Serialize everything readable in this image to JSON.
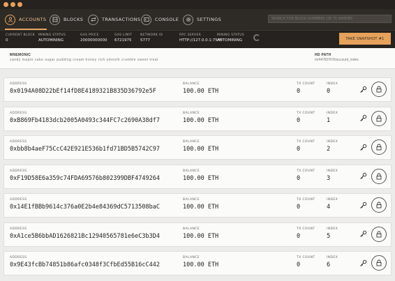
{
  "nav": {
    "items": [
      {
        "label": "ACCOUNTS",
        "icon": "accounts-icon",
        "active": true
      },
      {
        "label": "BLOCKS",
        "icon": "blocks-icon",
        "active": false
      },
      {
        "label": "TRANSACTIONS",
        "icon": "transactions-icon",
        "active": false
      },
      {
        "label": "CONSOLE",
        "icon": "console-icon",
        "active": false
      },
      {
        "label": "SETTINGS",
        "icon": "settings-icon",
        "active": false
      }
    ],
    "search_placeholder": "SEARCH FOR BLOCK NUMBERS OR TX HASHES"
  },
  "status": {
    "current_block": {
      "label": "CURRENT BLOCK",
      "value": "0"
    },
    "gas_price": {
      "label": "GAS PRICE",
      "value": "20000000000"
    },
    "gas_limit": {
      "label": "GAS LIMIT",
      "value": "6721975"
    },
    "network_id": {
      "label": "NETWORK ID",
      "value": "5777"
    },
    "rpc_server": {
      "label": "RPC SERVER",
      "value": "HTTP://127.0.0.1:7545"
    },
    "mining_status": {
      "label": "MINING STATUS",
      "value": "AUTOMINING"
    },
    "snapshot_button": "TAKE SNAPSHOT #1"
  },
  "mnemonic": {
    "label": "MNEMONIC",
    "value": "candy maple cake sugar pudding cream honey rich smooth crumble sweet treat",
    "hd_path_label": "HD PATH",
    "hd_path_value": "m/44'/60'/0'/0/account_index"
  },
  "labels": {
    "address": "ADDRESS",
    "balance": "BALANCE",
    "tx_count": "TX COUNT",
    "index": "INDEX"
  },
  "accounts": [
    {
      "address": "0x0194A08D22bEf14fD8E4189321B835D36792e5F",
      "balance": "100.00 ETH",
      "tx_count": "0",
      "index": "0"
    },
    {
      "address": "0xB869Fb4183dcb2005A0493c344FC7c2690A38df7",
      "balance": "100.00 ETH",
      "tx_count": "0",
      "index": "1"
    },
    {
      "address": "0xbb8b4aeF75CcC42E921E536b1fd71BD5B5742C97",
      "balance": "100.00 ETH",
      "tx_count": "0",
      "index": "2"
    },
    {
      "address": "0xF19D58E6a359c74FDA69576b802399DBF4749264",
      "balance": "100.00 ETH",
      "tx_count": "0",
      "index": "3"
    },
    {
      "address": "0x14E1fBBb9614c376a0E2b4e84369dC5713508baC",
      "balance": "100.00 ETH",
      "tx_count": "0",
      "index": "4"
    },
    {
      "address": "0xA1ce5B6bbAD1626821Bc12940565781e6eC3b3D4",
      "balance": "100.00 ETH",
      "tx_count": "0",
      "index": "5"
    },
    {
      "address": "0x9E43fcBb74851b86afc0348f3CfbEd55B16cC442",
      "balance": "100.00 ETH",
      "tx_count": "0",
      "index": "6"
    }
  ],
  "colors": {
    "accent": "#e6a15a",
    "nav_bg": "#2e2a26",
    "status_bg": "#25221f",
    "page_bg": "#ececea"
  }
}
